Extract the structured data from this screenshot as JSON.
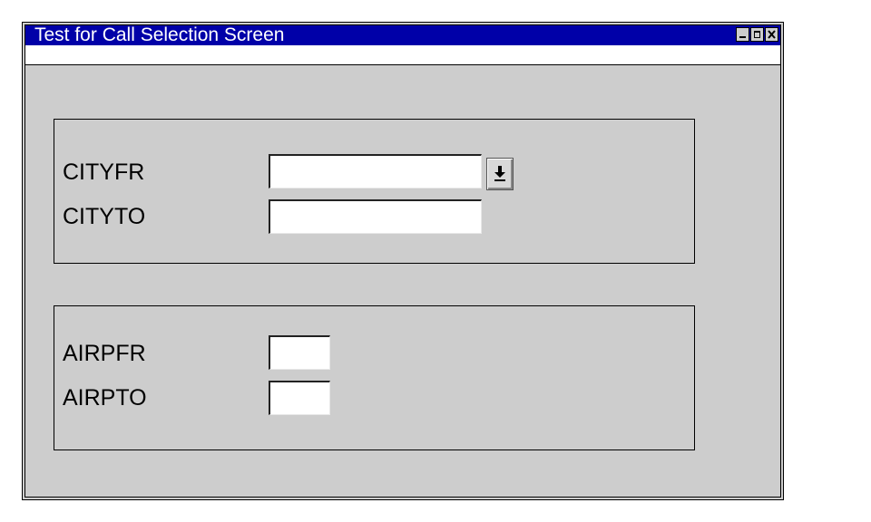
{
  "window": {
    "title": "Test for Call Selection Screen"
  },
  "group_city": {
    "fields": [
      {
        "label": "CITYFR",
        "value": ""
      },
      {
        "label": "CITYTO",
        "value": ""
      }
    ]
  },
  "group_airport": {
    "fields": [
      {
        "label": "AIRPFR",
        "value": ""
      },
      {
        "label": "AIRPTO",
        "value": ""
      }
    ]
  },
  "colors": {
    "titlebar": "#0000a8",
    "window_bg": "#cdcdcd",
    "field_bg": "#ffffff"
  },
  "icons": {
    "dropdown": "dropdown-arrow-icon",
    "minimize": "minimize-icon",
    "maximize": "maximize-icon",
    "close": "close-icon"
  }
}
